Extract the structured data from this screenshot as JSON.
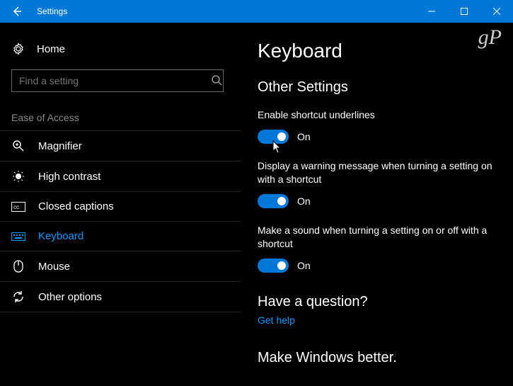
{
  "titlebar": {
    "title": "Settings"
  },
  "watermark": "gP",
  "sidebar": {
    "home": "Home",
    "search_placeholder": "Find a setting",
    "category": "Ease of Access",
    "items": [
      {
        "label": "Magnifier"
      },
      {
        "label": "High contrast"
      },
      {
        "label": "Closed captions"
      },
      {
        "label": "Keyboard"
      },
      {
        "label": "Mouse"
      },
      {
        "label": "Other options"
      }
    ]
  },
  "main": {
    "title": "Keyboard",
    "section": "Other Settings",
    "settings": [
      {
        "label": "Enable shortcut underlines",
        "state": "On"
      },
      {
        "label": "Display a warning message when turning a setting on with a shortcut",
        "state": "On"
      },
      {
        "label": "Make a sound when turning a setting on or off with a shortcut",
        "state": "On"
      }
    ],
    "question_heading": "Have a question?",
    "help_link": "Get help",
    "better_heading": "Make Windows better."
  }
}
